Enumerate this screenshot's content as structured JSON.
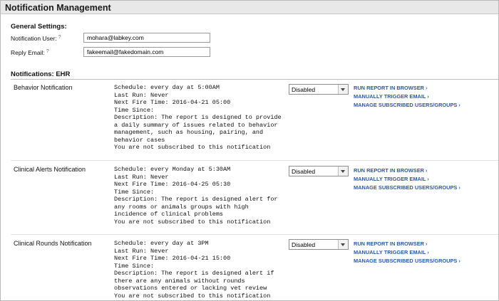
{
  "panel": {
    "title": "Notification Management"
  },
  "general": {
    "heading": "General Settings:",
    "user_label": "Notification User:",
    "user_value": "mohara@labkey.com",
    "reply_label": "Reply Email:",
    "reply_value": "fakeemail@fakedomain.com",
    "help_glyph": "?"
  },
  "notifications": {
    "heading": "Notifications: EHR",
    "actions": {
      "run": "RUN REPORT IN BROWSER",
      "trigger": "MANUALLY TRIGGER EMAIL",
      "manage": "MANAGE SUBSCRIBED USERS/GROUPS",
      "chevron": "›"
    },
    "items": [
      {
        "name": "Behavior Notification",
        "schedule": "Schedule: every day at 5:00AM",
        "last_run": "Last Run: Never",
        "next_fire": "Next Fire Time: 2016-04-21 05:00",
        "time_since": "Time Since:",
        "description": "Description: The report is designed to provide a daily summary of issues related to behavior management, such as housing, pairing, and behavior cases",
        "subscription": "You are not subscribed to this notification",
        "status": "Disabled"
      },
      {
        "name": "Clinical Alerts Notification",
        "schedule": "Schedule: every Monday at 5:30AM",
        "last_run": "Last Run: Never",
        "next_fire": "Next Fire Time: 2016-04-25 05:30",
        "time_since": "Time Since:",
        "description": "Description: The report is designed alert for any rooms or animals groups with high incidence of clinical problems",
        "subscription": "You are not subscribed to this notification",
        "status": "Disabled"
      },
      {
        "name": "Clinical Rounds Notification",
        "schedule": "Schedule: every day at 3PM",
        "last_run": "Last Run: Never",
        "next_fire": "Next Fire Time: 2016-04-21 15:00",
        "time_since": "Time Since:",
        "description": "Description: The report is designed alert if there are any animals without rounds observations entered or lacking vet review",
        "subscription": "You are not subscribed to this notification",
        "status": "Disabled"
      }
    ]
  }
}
